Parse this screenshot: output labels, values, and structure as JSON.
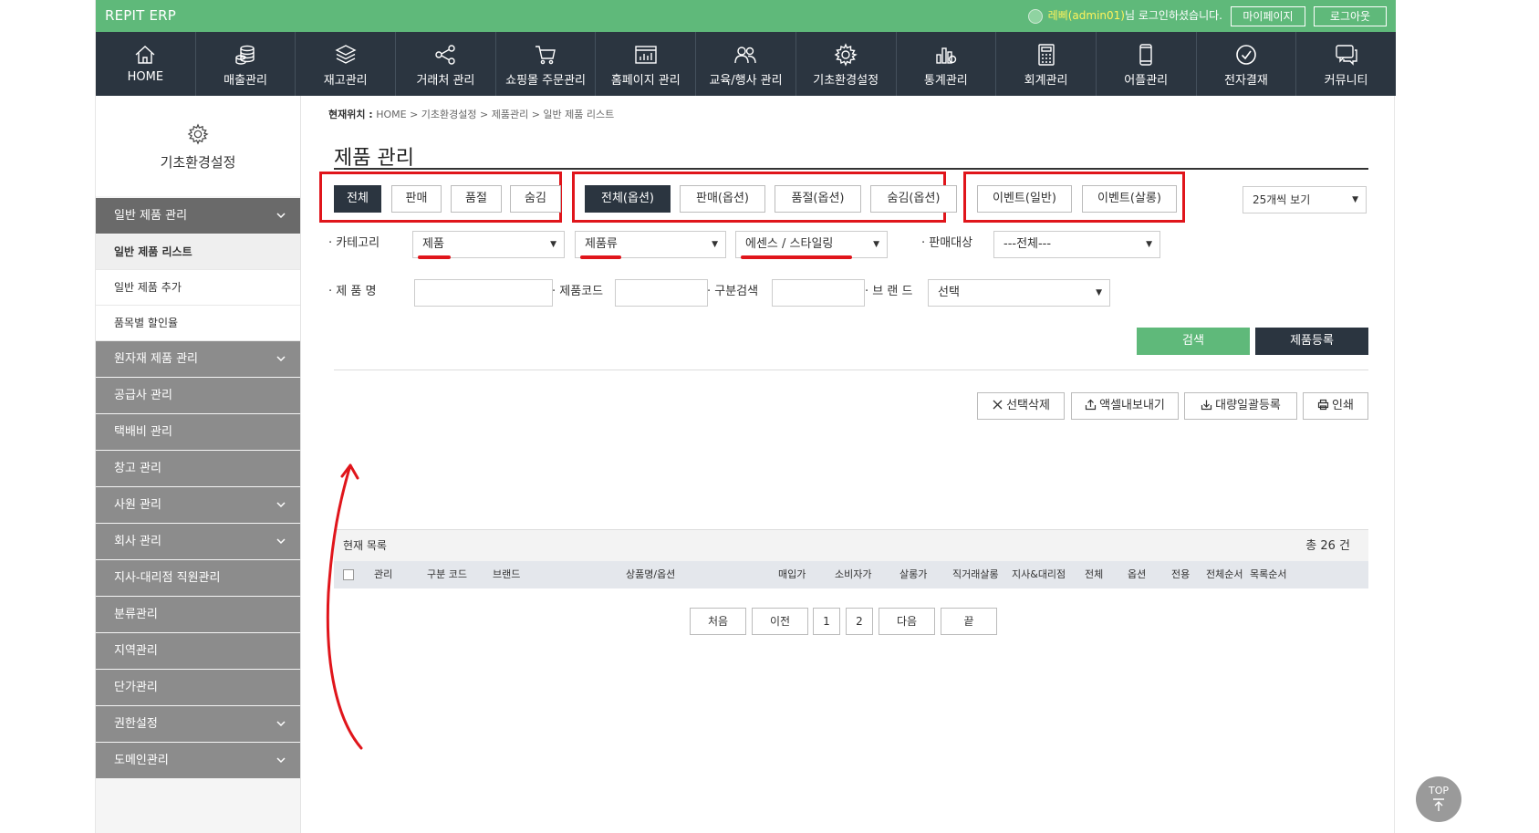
{
  "topbar": {
    "brand": "REPIT ERP",
    "user_name": "레삐(admin01)",
    "user_suffix": "님 로그인하셨습니다.",
    "mypage_label": "마이페이지",
    "logout_label": "로그아웃"
  },
  "nav": {
    "items": [
      {
        "label": "HOME",
        "icon": "home-icon"
      },
      {
        "label": "매출관리",
        "icon": "coins-icon"
      },
      {
        "label": "재고관리",
        "icon": "layers-icon"
      },
      {
        "label": "거래처 관리",
        "icon": "share-icon"
      },
      {
        "label": "쇼핑몰 주문관리",
        "icon": "cart-icon"
      },
      {
        "label": "홈페이지 관리",
        "icon": "browser-icon"
      },
      {
        "label": "교육/행사 관리",
        "icon": "people-icon"
      },
      {
        "label": "기초환경설정",
        "icon": "gear-icon"
      },
      {
        "label": "통계관리",
        "icon": "chart-icon"
      },
      {
        "label": "회계관리",
        "icon": "calculator-icon"
      },
      {
        "label": "어플관리",
        "icon": "mobile-icon"
      },
      {
        "label": "전자결재",
        "icon": "check-circle-icon"
      },
      {
        "label": "커뮤니티",
        "icon": "chat-icon"
      }
    ]
  },
  "sidebar": {
    "title": "기초환경설정",
    "group_active": "일반 제품 관리",
    "sub_items": [
      "일반 제품 리스트",
      "일반 제품 추가",
      "품목별 할인율"
    ],
    "groups": [
      {
        "label": "원자재 제품 관리",
        "chevron": true
      },
      {
        "label": "공급사 관리",
        "chevron": false
      },
      {
        "label": "택배비 관리",
        "chevron": false
      },
      {
        "label": "창고 관리",
        "chevron": false
      },
      {
        "label": "사원 관리",
        "chevron": true
      },
      {
        "label": "회사 관리",
        "chevron": true
      },
      {
        "label": "지사-대리점 직원관리",
        "chevron": false
      },
      {
        "label": "분류관리",
        "chevron": false
      },
      {
        "label": "지역관리",
        "chevron": false
      },
      {
        "label": "단가관리",
        "chevron": false
      },
      {
        "label": "권한설정",
        "chevron": true
      },
      {
        "label": "도메인관리",
        "chevron": true
      }
    ]
  },
  "content": {
    "breadcrumb_label": "현재위치 :",
    "breadcrumb_path": " HOME > 기초환경설정 > 제품관리 > 일반 제품 리스트",
    "page_title": "제품 관리",
    "filter_group1": [
      "전체",
      "판매",
      "품절",
      "숨김"
    ],
    "filter_group2": [
      "전체(옵션)",
      "판매(옵션)",
      "품절(옵션)",
      "숨김(옵션)"
    ],
    "filter_group3": [
      "이벤트(일반)",
      "이벤트(살롱)"
    ],
    "page_size": "25개씩 보기",
    "category_label": "· 카테고리",
    "category1": "제품",
    "category2": "제품류",
    "category3": "에센스 / 스타일링",
    "sale_target_label": "· 판매대상",
    "sale_target": "---전체---",
    "product_name_label": "· 제 품 명",
    "product_code_label": "· 제품코드",
    "section_search_label": "· 구분검색",
    "brand_label": "· 브 랜 드",
    "brand_value": "선택",
    "search_button": "검색",
    "register_button": "제품등록",
    "tools": [
      "선택삭제",
      "액셀내보내기",
      "대량일괄등록",
      "인쇄"
    ],
    "list_title": "현재 목록",
    "total_prefix": "총 ",
    "total_count": "26",
    "total_suffix": " 건",
    "columns": [
      "관리",
      "구분 코드",
      "브랜드",
      "상품명/옵션",
      "매입가",
      "소비자가",
      "살롱가",
      "직거래살롱",
      "지사&대리점",
      "전체",
      "옵션",
      "전용",
      "전체순서",
      "목록순서"
    ],
    "pager": [
      "처음",
      "이전",
      "1",
      "2",
      "다음",
      "끝"
    ],
    "top_button": "TOP"
  },
  "colors": {
    "topbar": "#5fb97a",
    "nav": "#2b3540",
    "sidebar_group": "#8c8c8c",
    "highlight": "#e0151b",
    "search_button": "#5fb97a"
  }
}
